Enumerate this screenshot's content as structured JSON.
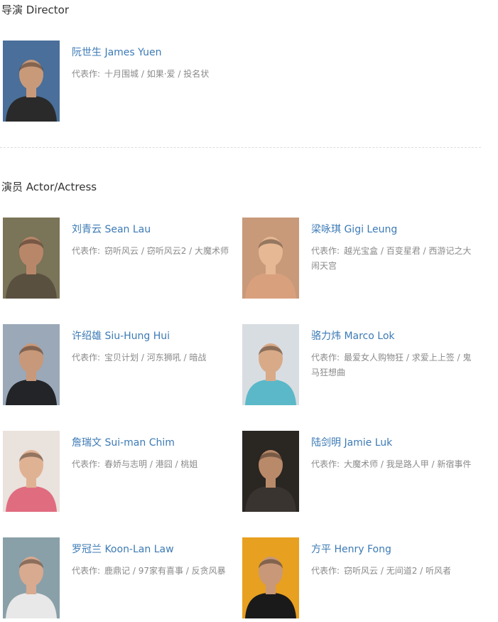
{
  "director_section": {
    "title": "导演 Director",
    "people": [
      {
        "name": "阮世生 James Yuen",
        "works": "十月围城 / 如果·爱 / 投名状"
      }
    ]
  },
  "actor_section": {
    "title": "演员 Actor/Actress",
    "people": [
      {
        "name": "刘青云 Sean Lau",
        "works": "窃听风云 / 窃听风云2 / 大魔术师"
      },
      {
        "name": "梁咏琪 Gigi Leung",
        "works": "越光宝盒 / 百变星君 / 西游记之大闹天宫"
      },
      {
        "name": "许绍雄 Siu-Hung Hui",
        "works": "宝贝计划 / 河东狮吼 / 暗战"
      },
      {
        "name": "骆力炜 Marco Lok",
        "works": "最爱女人购物狂 / 求爱上上签 / 鬼马狂想曲"
      },
      {
        "name": "詹瑞文 Sui-man Chim",
        "works": "春娇与志明 / 港囧 / 桃姐"
      },
      {
        "name": "陆剑明 Jamie Luk",
        "works": "大魔术师 / 我是路人甲 / 新宿事件"
      },
      {
        "name": "罗冠兰 Koon-Lan Law",
        "works": "鹿鼎记 / 97家有喜事 / 反贪风暴"
      },
      {
        "name": "方平 Henry Fong",
        "works": "窃听风云 / 无间道2 / 听风者"
      }
    ]
  },
  "works_label": "代表作:",
  "photo_colors": {
    "james-yuen": {
      "bg": "#4a6f9a",
      "skin": "#c99a7a",
      "cloth": "#2a2a2a"
    },
    "sean-lau": {
      "bg": "#7a7458",
      "skin": "#b8876a",
      "cloth": "#5a5040"
    },
    "gigi-leung": {
      "bg": "#c89a7a",
      "skin": "#e6b894",
      "cloth": "#d9a07e"
    },
    "siu-hung-hui": {
      "bg": "#9aa8b8",
      "skin": "#c8987a",
      "cloth": "#222428"
    },
    "marco-lok": {
      "bg": "#d8dde2",
      "skin": "#d8aa88",
      "cloth": "#5ab8c8"
    },
    "sui-man-chim": {
      "bg": "#eae2dc",
      "skin": "#e0b294",
      "cloth": "#e06c80"
    },
    "jamie-luk": {
      "bg": "#2a2622",
      "skin": "#b88a6a",
      "cloth": "#3a3430"
    },
    "koon-lan-law": {
      "bg": "#8aa0a8",
      "skin": "#d8aa90",
      "cloth": "#e8e8e8"
    },
    "henry-fong": {
      "bg": "#e8a020",
      "skin": "#c89878",
      "cloth": "#1a1a1a"
    }
  }
}
